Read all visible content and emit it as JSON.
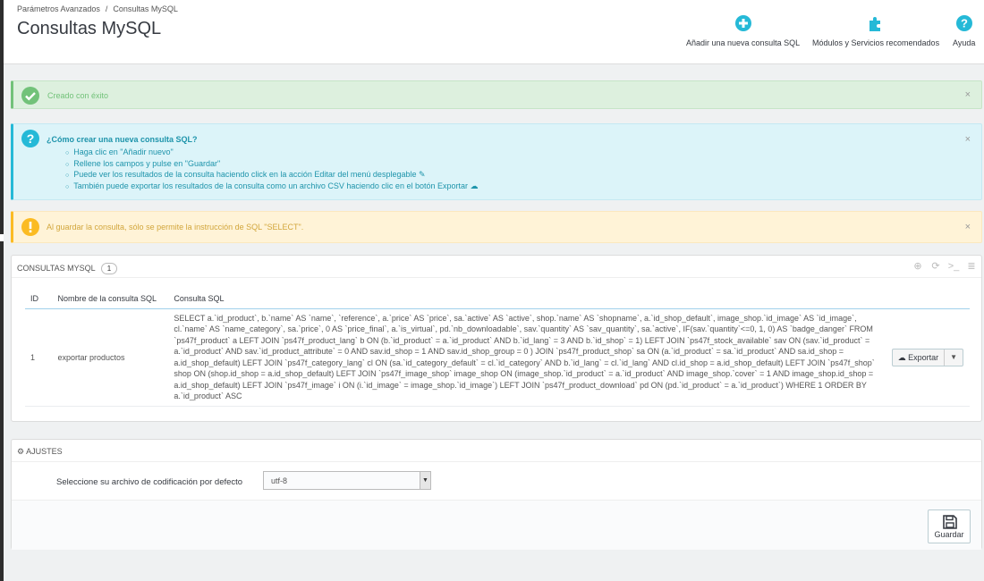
{
  "breadcrumb": {
    "parent": "Parámetros Avanzados",
    "separator": "/",
    "current": "Consultas MySQL"
  },
  "page_title": "Consultas MySQL",
  "toolbar": {
    "add_label": "Añadir una nueva consulta SQL",
    "modules_label": "Módulos y Servicios recomendados",
    "help_label": "Ayuda"
  },
  "success_alert": {
    "message": "Creado con éxito",
    "close": "×"
  },
  "info_alert": {
    "title": "¿Cómo crear una nueva consulta SQL?",
    "items": [
      "Haga clic en \"Añadir nuevo\"",
      "Rellene los campos y pulse en \"Guardar\"",
      "Puede ver los resultados de la consulta haciendo click en la acción Editar del menú desplegable",
      "También puede exportar los resultados de la consulta como un archivo CSV haciendo clic en el botón Exportar"
    ],
    "close": "×"
  },
  "warning_alert": {
    "message": "Al guardar la consulta, sólo se permite la instrucción de SQL \"SELECT\".",
    "close": "×"
  },
  "sql_panel": {
    "title": "Consultas MySQL",
    "count": "1",
    "columns": [
      "ID",
      "Nombre de la consulta SQL",
      "Consulta SQL"
    ],
    "rows": [
      {
        "id": "1",
        "name": "exportar productos",
        "query": "SELECT a.`id_product`, b.`name` AS `name`, `reference`, a.`price` AS `price`, sa.`active` AS `active`, shop.`name` AS `shopname`, a.`id_shop_default`, image_shop.`id_image` AS `id_image`, cl.`name` AS `name_category`, sa.`price`, 0 AS `price_final`, a.`is_virtual`, pd.`nb_downloadable`, sav.`quantity` AS `sav_quantity`, sa.`active`, IF(sav.`quantity`<=0, 1, 0) AS `badge_danger` FROM `ps47f_product` a LEFT JOIN `ps47f_product_lang` b ON (b.`id_product` = a.`id_product` AND b.`id_lang` = 3 AND b.`id_shop` = 1) LEFT JOIN `ps47f_stock_available` sav ON (sav.`id_product` = a.`id_product` AND sav.`id_product_attribute` = 0 AND sav.id_shop = 1 AND sav.id_shop_group = 0 ) JOIN `ps47f_product_shop` sa ON (a.`id_product` = sa.`id_product` AND sa.id_shop = a.id_shop_default) LEFT JOIN `ps47f_category_lang` cl ON (sa.`id_category_default` = cl.`id_category` AND b.`id_lang` = cl.`id_lang` AND cl.id_shop = a.id_shop_default) LEFT JOIN `ps47f_shop` shop ON (shop.id_shop = a.id_shop_default) LEFT JOIN `ps47f_image_shop` image_shop ON (image_shop.`id_product` = a.`id_product` AND image_shop.`cover` = 1 AND image_shop.id_shop = a.id_shop_default) LEFT JOIN `ps47f_image` i ON (i.`id_image` = image_shop.`id_image`) LEFT JOIN `ps47f_product_download` pd ON (pd.`id_product` = a.`id_product`) WHERE 1 ORDER BY a.`id_product` ASC",
        "export_label": "Exportar"
      }
    ]
  },
  "settings_panel": {
    "title": "Ajustes",
    "encoding_label": "Seleccione su archivo de codificación por defecto",
    "encoding_value": "utf-8",
    "save_label": "Guardar"
  },
  "colors": {
    "success": "#72c279",
    "info": "#25b9d7",
    "warning": "#fbbb22",
    "primary": "#25b9d7"
  }
}
